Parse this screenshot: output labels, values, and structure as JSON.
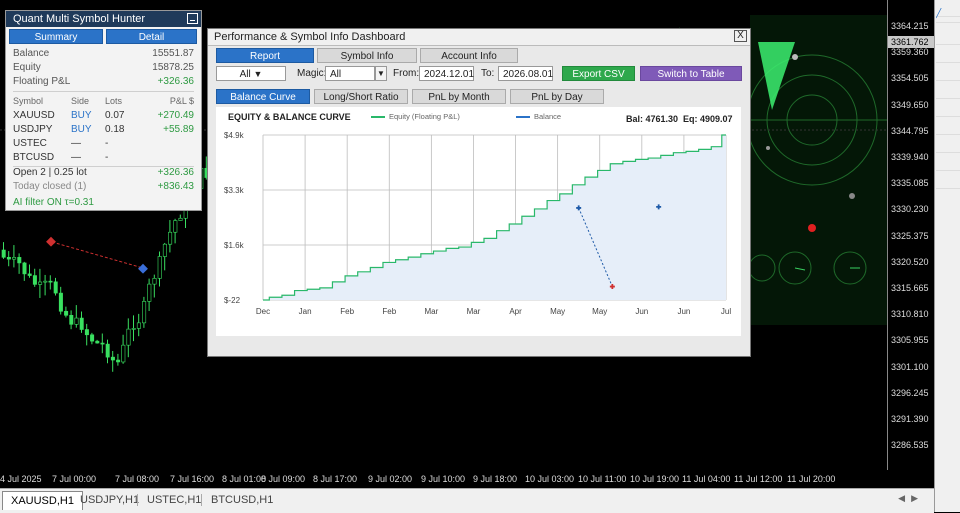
{
  "hunter": {
    "title": "Quant Multi Symbol Hunter",
    "tab_summary": "Summary",
    "tab_detail": "Detail",
    "balance_label": "Balance",
    "balance_value": "15551.87",
    "equity_label": "Equity",
    "equity_value": "15878.25",
    "floating_label": "Floating P&L",
    "floating_value": "+326.36",
    "col_symbol": "Symbol",
    "col_side": "Side",
    "col_lots": "Lots",
    "col_pl": "P&L $",
    "rows": [
      {
        "symbol": "XAUUSD",
        "side": "BUY",
        "lots": "0.07",
        "pl": "+270.49"
      },
      {
        "symbol": "USDJPY",
        "side": "BUY",
        "lots": "0.18",
        "pl": "+55.89"
      },
      {
        "symbol": "USTEC",
        "side": "—",
        "lots": "-",
        "pl": ""
      },
      {
        "symbol": "BTCUSD",
        "side": "—",
        "lots": "-",
        "pl": ""
      }
    ],
    "open_label": "Open 2 | 0.25 lot",
    "open_value": "+326.36",
    "closed_label": "Today closed (1)",
    "closed_value": "+836.43",
    "ai_filter": "AI filter ON  τ=0.31"
  },
  "dashboard": {
    "title": "Performance & Symbol Info Dashboard",
    "close": "X",
    "tabs": [
      "Report",
      "Symbol Info",
      "Account Info"
    ],
    "filter_all": "All",
    "filter_all_arrow": "▼",
    "magic_label": "Magic:",
    "magic_value": "All",
    "magic_arrow": "▼",
    "from_label": "From:",
    "from_value": "2024.12.01",
    "to_label": "To:",
    "to_value": "2026.08.01",
    "export_label": "Export CSV",
    "switch_label": "Switch to Table",
    "subtabs": [
      "Balance Curve",
      "Long/Short Ratio",
      "PnL by Month",
      "PnL by Day"
    ]
  },
  "chart_data": {
    "type": "line",
    "title": "EQUITY & BALANCE CURVE",
    "legend": [
      {
        "name": "Equity (Floating P&L)",
        "color": "#29b86a"
      },
      {
        "name": "Balance",
        "color": "#2b73c8"
      }
    ],
    "bal_text": "Bal: 4761.30",
    "eq_text": "Eq: 4909.07",
    "y_ticks": [
      "$4.9k",
      "$3.3k",
      "$1.6k",
      "$-22"
    ],
    "ylim": [
      -22,
      4909
    ],
    "x_ticks": [
      "Dec",
      "Jan",
      "Feb",
      "Feb",
      "Mar",
      "Mar",
      "Apr",
      "May",
      "May",
      "Jun",
      "Jun",
      "Jul"
    ],
    "equity_series": [
      [
        0,
        -22
      ],
      [
        0.3,
        60
      ],
      [
        0.6,
        120
      ],
      [
        0.9,
        260
      ],
      [
        1.2,
        300
      ],
      [
        1.5,
        340
      ],
      [
        1.8,
        520
      ],
      [
        2.1,
        700
      ],
      [
        2.4,
        820
      ],
      [
        2.7,
        950
      ],
      [
        3.0,
        1100
      ],
      [
        3.3,
        1180
      ],
      [
        3.6,
        1260
      ],
      [
        3.9,
        1360
      ],
      [
        4.2,
        1440
      ],
      [
        4.5,
        1520
      ],
      [
        4.8,
        1560
      ],
      [
        5.1,
        1700
      ],
      [
        5.4,
        1820
      ],
      [
        5.7,
        2050
      ],
      [
        6.0,
        2250
      ],
      [
        6.3,
        2480
      ],
      [
        6.6,
        2700
      ],
      [
        6.9,
        2950
      ],
      [
        7.2,
        3150
      ],
      [
        7.5,
        3420
      ],
      [
        7.8,
        3650
      ],
      [
        8.1,
        3850
      ],
      [
        8.4,
        4050
      ],
      [
        8.7,
        4120
      ],
      [
        9.0,
        4180
      ],
      [
        9.3,
        4220
      ],
      [
        9.6,
        4300
      ],
      [
        9.9,
        4380
      ],
      [
        10.2,
        4420
      ],
      [
        10.5,
        4480
      ],
      [
        10.8,
        4560
      ],
      [
        11.0,
        4909
      ]
    ],
    "scatter_points": [
      {
        "x": 7.5,
        "y": 2730,
        "color": "#1e5aa8"
      },
      {
        "x": 8.3,
        "y": 380,
        "color": "#d03030"
      },
      {
        "x": 9.4,
        "y": 2760,
        "color": "#1e5aa8"
      }
    ],
    "grid": true
  },
  "price_axis": {
    "labels": [
      "3364.215",
      "3359.360",
      "3354.505",
      "3349.650",
      "3344.795",
      "3339.940",
      "3335.085",
      "3330.230",
      "3325.375",
      "3320.520",
      "3315.665",
      "3310.810",
      "3305.955",
      "3301.100",
      "3296.245",
      "3291.390",
      "3286.535"
    ],
    "current": "3361.762"
  },
  "time_axis": {
    "labels": [
      "4 Jul 2025",
      "7 Jul 00:00",
      "7 Jul 08:00",
      "7 Jul 16:00",
      "8 Jul 01:00",
      "8 Jul 09:00",
      "8 Jul 17:00",
      "9 Jul 02:00",
      "9 Jul 10:00",
      "9 Jul 18:00",
      "10 Jul 03:00",
      "10 Jul 11:00",
      "10 Jul 19:00",
      "11 Jul 04:00",
      "11 Jul 12:00",
      "11 Jul 20:00"
    ]
  },
  "symbol_tabs": [
    "XAUUSD,H1",
    "USDJPY,H1",
    "USTEC,H1",
    "BTCUSD,H1"
  ]
}
